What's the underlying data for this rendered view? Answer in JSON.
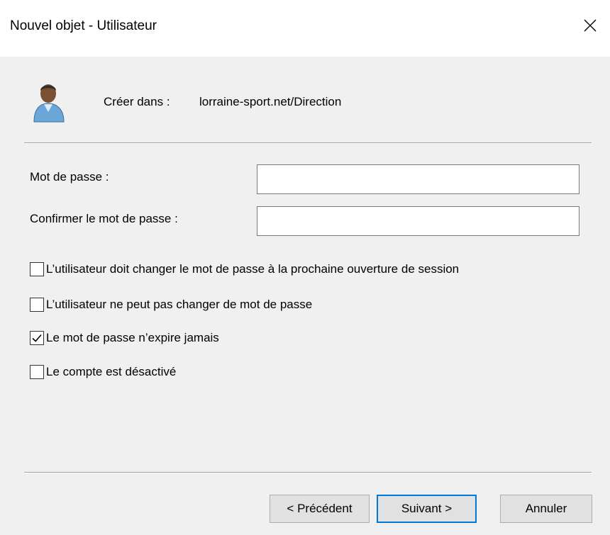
{
  "window": {
    "title": "Nouvel objet - Utilisateur",
    "close_icon": "close-icon"
  },
  "header": {
    "icon": "user-icon",
    "create_label": "Créer dans :",
    "create_path": "lorraine-sport.net/Direction"
  },
  "form": {
    "password_label": "Mot de passe :",
    "password_value": "",
    "confirm_label": "Confirmer le mot de passe :",
    "confirm_value": ""
  },
  "options": [
    {
      "label": "L’utilisateur doit changer le mot de passe à la prochaine ouverture de session",
      "checked": false
    },
    {
      "label": "L’utilisateur ne peut pas changer de mot de passe",
      "checked": false
    },
    {
      "label": "Le mot de passe n’expire jamais",
      "checked": true
    },
    {
      "label": "Le compte est désactivé",
      "checked": false
    }
  ],
  "buttons": {
    "previous": "< Précédent",
    "next": "Suivant >",
    "cancel": "Annuler"
  },
  "colors": {
    "default_button_border": "#0078d7",
    "dialog_background": "#f0f0f0",
    "title_background": "#ffffff"
  }
}
